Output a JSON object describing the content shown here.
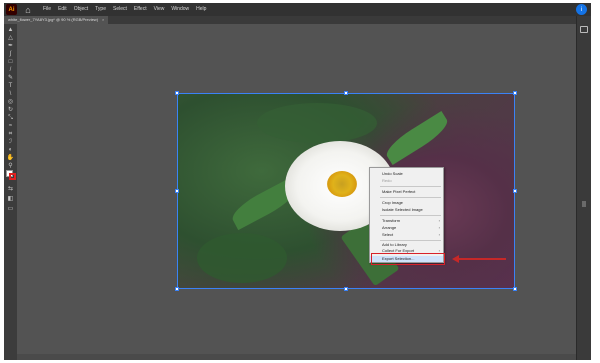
{
  "app": {
    "logo": "Ai",
    "home_icon": "home-icon",
    "user_initial": "i"
  },
  "menu": [
    "File",
    "Edit",
    "Object",
    "Type",
    "Select",
    "Effect",
    "View",
    "Window",
    "Help"
  ],
  "document_tab": {
    "title": "white_flower_7YA8Y3.jpg* @ 90 % (RGB/Preview)",
    "close": "×"
  },
  "toolbar_icons": [
    "selection-tool-icon",
    "direct-selection-tool-icon",
    "pen-tool-icon",
    "curvature-tool-icon",
    "rectangle-tool-icon",
    "paintbrush-tool-icon",
    "pencil-tool-icon",
    "type-tool-icon",
    "line-tool-icon",
    "shape-builder-icon",
    "rotate-tool-icon",
    "scale-tool-icon",
    "width-tool-icon",
    "free-transform-icon",
    "eyedropper-tool-icon",
    "blend-tool-icon",
    "artboard-tool-icon",
    "hand-tool-icon",
    "zoom-tool-icon"
  ],
  "context_menu": {
    "items": [
      {
        "label": "Undo Scale",
        "disabled": false
      },
      {
        "label": "Redo",
        "disabled": true
      },
      {
        "label": "Make Pixel Perfect",
        "disabled": false
      },
      {
        "label": "Crop Image",
        "disabled": false
      },
      {
        "label": "Isolate Selected Image",
        "disabled": false
      },
      {
        "label": "Transform",
        "disabled": false,
        "submenu": true
      },
      {
        "label": "Arrange",
        "disabled": false,
        "submenu": true
      },
      {
        "label": "Select",
        "disabled": false,
        "submenu": true
      },
      {
        "label": "Add to Library",
        "disabled": false
      },
      {
        "label": "Collect For Export",
        "disabled": false,
        "submenu": true
      },
      {
        "label": "Export Selection...",
        "disabled": false,
        "highlighted": true
      }
    ],
    "submenu_arrow": "›"
  },
  "colors": {
    "annotation_red": "#d8222a",
    "selection_blue": "#3b82f6",
    "canvas_gray": "#535353"
  }
}
